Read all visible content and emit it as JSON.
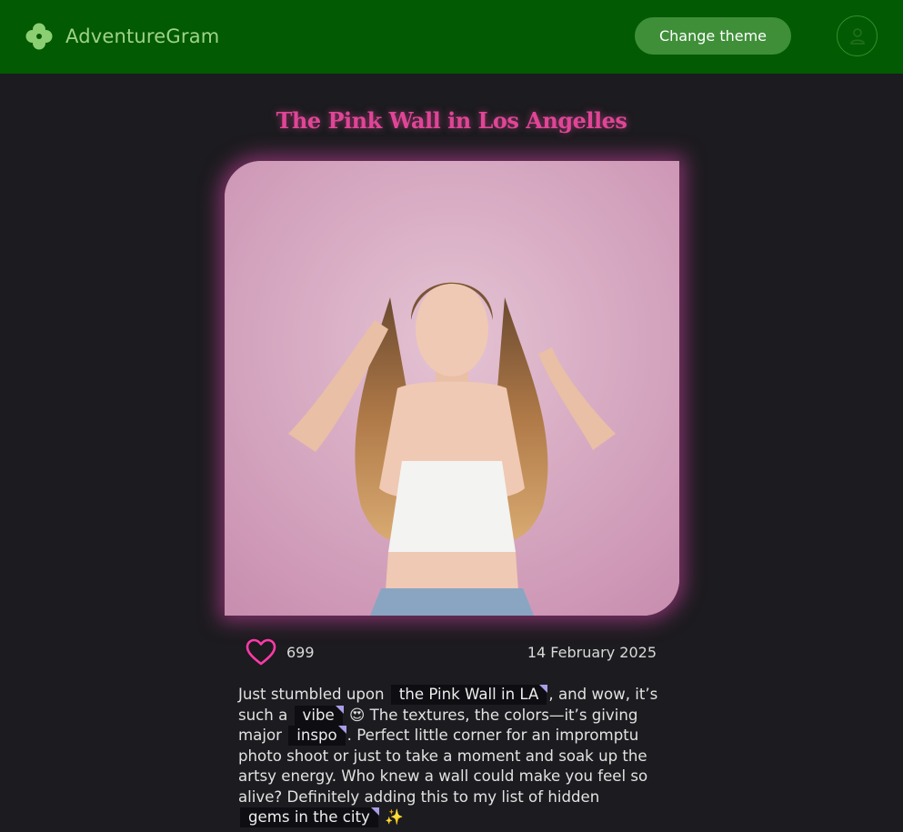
{
  "header": {
    "brand_name": "AdventureGram",
    "change_theme_label": "Change theme",
    "logo_icon": "clover-icon",
    "profile_icon": "user-icon"
  },
  "post": {
    "title": "The Pink Wall in Los Angelles",
    "likes": "699",
    "date": "14 February 2025",
    "caption": {
      "t1": "Just stumbled upon",
      "tag1": "the Pink Wall in LA",
      "t2": ", and wow, it’s such a",
      "tag2": "vibe",
      "t3": " 😍 The textures, the colors—it’s giving major",
      "tag3": "inspo",
      "t4": ". Perfect little corner for an impromptu photo shoot or just to take a moment and soak up the artsy energy. Who knew a wall could make you feel so alive? Definitely adding this to my list of hidden",
      "tag4": "gems in the city",
      "t5": " ✨"
    }
  },
  "colors": {
    "header_bg": "#025a02",
    "page_bg": "#1c1b1f",
    "title_pink": "#e04596",
    "heart_pink": "#ff3aa8",
    "brand_green": "#9ed386"
  }
}
